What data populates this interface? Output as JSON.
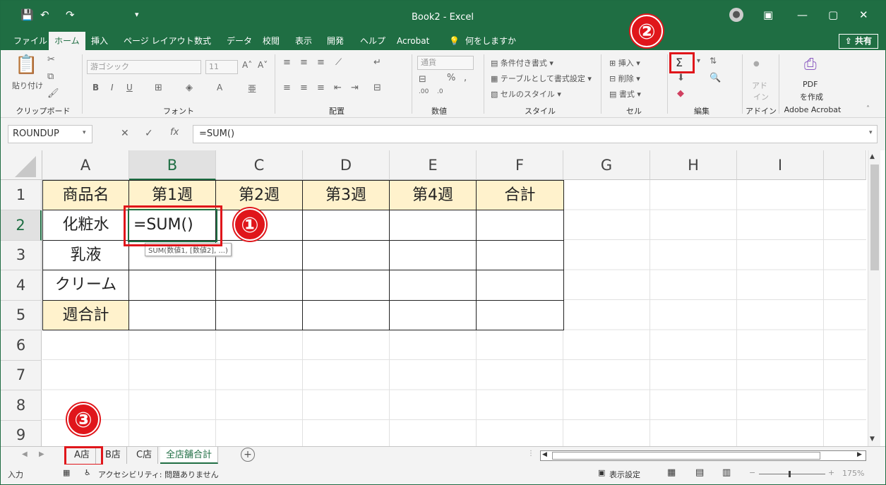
{
  "window": {
    "title": "Book2 - Excel"
  },
  "tabs": [
    "ファイル",
    "ホーム",
    "挿入",
    "ページ レイアウト",
    "数式",
    "データ",
    "校閲",
    "表示",
    "開発",
    "ヘルプ",
    "Acrobat"
  ],
  "search_hint": "何をしますか",
  "share_label": "共有",
  "ribbon": {
    "clipboard": {
      "label": "クリップボード",
      "paste": "貼り付け"
    },
    "font": {
      "label": "フォント",
      "name": "游ゴシック",
      "size": "11",
      "b": "B",
      "i": "I",
      "u": "U"
    },
    "alignment": {
      "label": "配置"
    },
    "number": {
      "label": "数値",
      "format": "通貨",
      "percent": "%"
    },
    "styles": {
      "label": "スタイル",
      "conditional": "条件付き書式",
      "table": "テーブルとして書式設定",
      "cell_style": "セルのスタイル"
    },
    "cells": {
      "label": "セル",
      "insert": "挿入",
      "delete": "削除",
      "format": "書式"
    },
    "editing": {
      "label": "編集",
      "sigma": "Σ"
    },
    "addins": {
      "label": "アドイン",
      "item1": "アド",
      "item2": "イン"
    },
    "acrobat": {
      "label": "Adobe Acrobat",
      "pdf1": "PDF",
      "pdf2": "を作成"
    }
  },
  "formula_bar": {
    "name_box": "ROUNDUP",
    "formula": "=SUM()",
    "fx": "fx"
  },
  "columns": [
    "A",
    "B",
    "C",
    "D",
    "E",
    "F",
    "G",
    "H",
    "I"
  ],
  "rows": [
    "1",
    "2",
    "3",
    "4",
    "5",
    "6",
    "7",
    "8",
    "9"
  ],
  "cells": {
    "A1": "商品名",
    "B1": "第1週",
    "C1": "第2週",
    "D1": "第3週",
    "E1": "第4週",
    "F1": "合計",
    "A2": "化粧水",
    "A3": "乳液",
    "A4": "クリーム",
    "A5": "週合計",
    "B2": "=SUM()"
  },
  "tooltip": "SUM(数値1, [数値2], ...)",
  "sheet_tabs": [
    "A店",
    "B店",
    "C店",
    "全店舗合計"
  ],
  "active_sheet": "全店舗合計",
  "status": {
    "mode": "入力",
    "accessibility": "アクセシビリティ: 問題ありません",
    "display_settings": "表示設定",
    "zoom": "175%"
  },
  "annotations": [
    "①",
    "②",
    "③"
  ],
  "colors": {
    "excel_green": "#1f6e43",
    "header_fill": "#fff2cc",
    "annotation_red": "#e0161b"
  }
}
